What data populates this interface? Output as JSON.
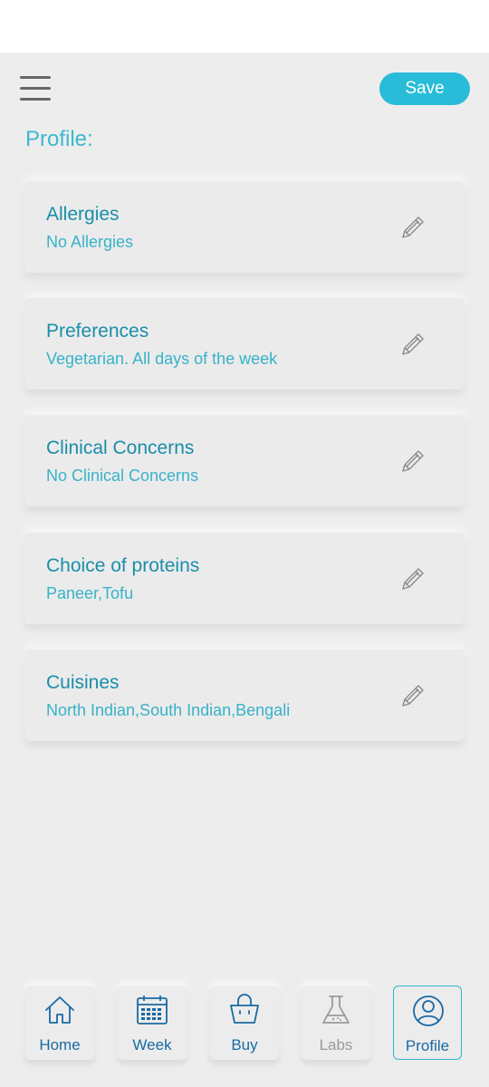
{
  "header": {
    "save_label": "Save",
    "title": "Profile:"
  },
  "cards": [
    {
      "title": "Allergies",
      "value": "No Allergies"
    },
    {
      "title": "Preferences",
      "value": "Vegetarian. All days of the week"
    },
    {
      "title": "Clinical Concerns",
      "value": "No Clinical Concerns"
    },
    {
      "title": "Choice of proteins",
      "value": "Paneer,Tofu"
    },
    {
      "title": "Cuisines",
      "value": "North Indian,South Indian,Bengali"
    }
  ],
  "nav": [
    {
      "label": "Home",
      "icon": "home-icon"
    },
    {
      "label": "Week",
      "icon": "calendar-icon"
    },
    {
      "label": "Buy",
      "icon": "shopping-bag-icon"
    },
    {
      "label": "Labs",
      "icon": "flask-icon"
    },
    {
      "label": "Profile",
      "icon": "user-icon",
      "active": true
    }
  ],
  "colors": {
    "accent": "#29bcd8",
    "card_title": "#1a8eaa",
    "card_value": "#37b3c8",
    "nav_label": "#1a6aa3",
    "background": "#ededed"
  }
}
